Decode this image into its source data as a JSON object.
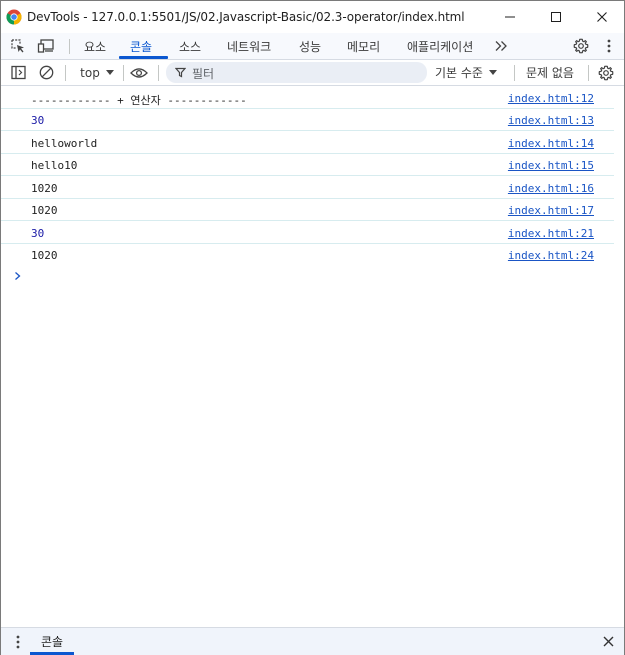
{
  "window": {
    "title": "DevTools - 127.0.0.1:5501/JS/02.Javascript-Basic/02.3-operator/index.html"
  },
  "tabs": [
    {
      "label": "요소",
      "active": false
    },
    {
      "label": "콘솔",
      "active": true
    },
    {
      "label": "소스",
      "active": false
    },
    {
      "label": "네트워크",
      "active": false
    },
    {
      "label": "성능",
      "active": false
    },
    {
      "label": "메모리",
      "active": false
    },
    {
      "label": "애플리케이션",
      "active": false
    }
  ],
  "toolbar": {
    "context": "top",
    "filter_placeholder": "필터",
    "levels": "기본 수준",
    "issues": "문제 없음"
  },
  "logs": [
    {
      "message": "------------ + 연산자 ------------",
      "source": "index.html:12",
      "type": "string"
    },
    {
      "message": "30",
      "source": "index.html:13",
      "type": "number"
    },
    {
      "message": "helloworld",
      "source": "index.html:14",
      "type": "string"
    },
    {
      "message": "hello10",
      "source": "index.html:15",
      "type": "string"
    },
    {
      "message": "1020",
      "source": "index.html:16",
      "type": "string"
    },
    {
      "message": "1020",
      "source": "index.html:17",
      "type": "string"
    },
    {
      "message": "30",
      "source": "index.html:21",
      "type": "number"
    },
    {
      "message": "1020",
      "source": "index.html:24",
      "type": "string"
    }
  ],
  "drawer": {
    "tab_label": "콘솔"
  },
  "colors": {
    "accent": "#0b57d0",
    "number_log": "#1a1aa6",
    "link": "#1a55c5"
  }
}
